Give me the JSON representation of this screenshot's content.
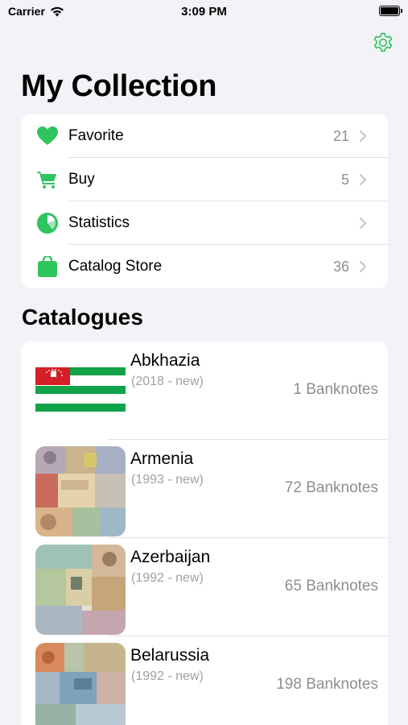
{
  "status_bar": {
    "carrier": "Carrier",
    "time": "3:09 PM"
  },
  "header": {
    "title": "My Collection"
  },
  "colors": {
    "accent": "#2ec55f",
    "chevron": "#c4c4c8"
  },
  "menu": {
    "items": [
      {
        "label": "Favorite",
        "count": "21",
        "icon": "heart-icon"
      },
      {
        "label": "Buy",
        "count": "5",
        "icon": "cart-icon"
      },
      {
        "label": "Statistics",
        "count": "",
        "icon": "pie-chart-icon"
      },
      {
        "label": "Catalog Store",
        "count": "36",
        "icon": "shopping-bag-icon"
      }
    ]
  },
  "catalogues": {
    "title": "Catalogues",
    "items": [
      {
        "name": "Abkhazia",
        "years": "(2018 - new)",
        "count": "1 Banknotes",
        "thumb": "abkhazia-flag"
      },
      {
        "name": "Armenia",
        "years": "(1993 - new)",
        "count": "72 Banknotes",
        "thumb": "armenia-banknotes"
      },
      {
        "name": "Azerbaijan",
        "years": "(1992 - new)",
        "count": "65 Banknotes",
        "thumb": "azerbaijan-banknotes"
      },
      {
        "name": "Belarussia",
        "years": "(1992 - new)",
        "count": "198 Banknotes",
        "thumb": "belarussia-banknotes"
      }
    ]
  }
}
